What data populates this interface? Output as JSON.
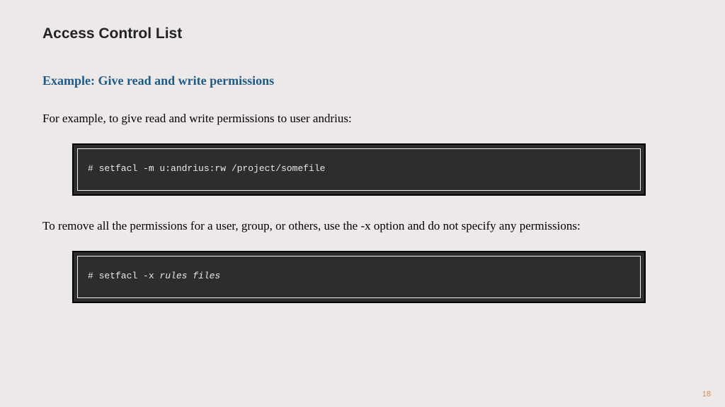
{
  "title": "Access Control List",
  "subtitle": "Example: Give read and write permissions",
  "para1": "For example, to give read and write permissions to user andrius:",
  "code1": "# setfacl -m u:andrius:rw /project/somefile",
  "para2": "To remove all the permissions for a user, group, or others, use the -x option and do not specify any permissions:",
  "code2_prefix": "# setfacl -x ",
  "code2_args": "rules files",
  "pagenum": "18"
}
